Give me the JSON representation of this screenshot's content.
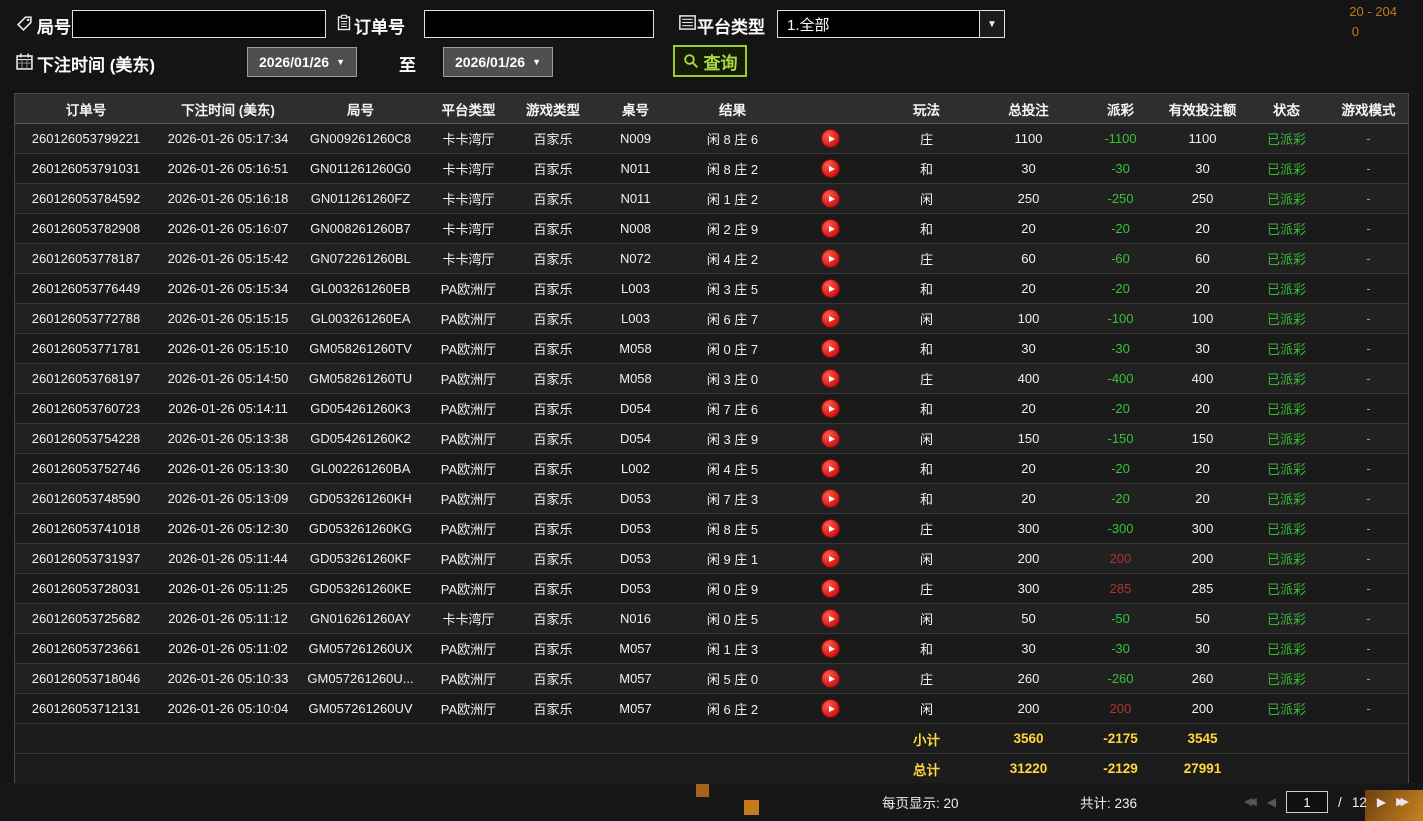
{
  "filters": {
    "round": {
      "label": "局号",
      "value": ""
    },
    "order": {
      "label": "订单号",
      "value": ""
    },
    "platform": {
      "label": "平台类型",
      "value": "1.全部"
    },
    "bet_time_label": "下注时间 (美东)",
    "date_from": "2026/01/26",
    "to_label": "至",
    "date_to": "2026/01/26",
    "query_label": "查询"
  },
  "icons": {
    "round": "tag-icon",
    "order": "clipboard-icon",
    "platform": "list-icon",
    "bet_time": "calendar-icon",
    "query": "search-icon",
    "replay": "play-icon",
    "dropdown": "chevron-down-icon"
  },
  "colors": {
    "query_green": "#99cc33",
    "loss_green": "#35c335",
    "win_red": "#b03434",
    "status_green": "#37b837",
    "summary_yellow": "#ffd83d",
    "replay_red": "#d41414",
    "artifact_orange": "#c2791c"
  },
  "table": {
    "headers": [
      "订单号",
      "下注时间 (美东)",
      "局号",
      "平台类型",
      "游戏类型",
      "桌号",
      "结果",
      "",
      "玩法",
      "总投注",
      "派彩",
      "有效投注额",
      "状态",
      "游戏模式"
    ],
    "rows": [
      [
        "260126053799221",
        "2026-01-26 05:17:34",
        "GN009261260C8",
        "卡卡湾厅",
        "百家乐",
        "N009",
        "闲 8 庄 6",
        "庄",
        "1100",
        "-1100",
        "1100",
        "已派彩",
        "-"
      ],
      [
        "260126053791031",
        "2026-01-26 05:16:51",
        "GN011261260G0",
        "卡卡湾厅",
        "百家乐",
        "N011",
        "闲 8 庄 2",
        "和",
        "30",
        "-30",
        "30",
        "已派彩",
        "-"
      ],
      [
        "260126053784592",
        "2026-01-26 05:16:18",
        "GN011261260FZ",
        "卡卡湾厅",
        "百家乐",
        "N011",
        "闲 1 庄 2",
        "闲",
        "250",
        "-250",
        "250",
        "已派彩",
        "-"
      ],
      [
        "260126053782908",
        "2026-01-26 05:16:07",
        "GN008261260B7",
        "卡卡湾厅",
        "百家乐",
        "N008",
        "闲 2 庄 9",
        "和",
        "20",
        "-20",
        "20",
        "已派彩",
        "-"
      ],
      [
        "260126053778187",
        "2026-01-26 05:15:42",
        "GN072261260BL",
        "卡卡湾厅",
        "百家乐",
        "N072",
        "闲 4 庄 2",
        "庄",
        "60",
        "-60",
        "60",
        "已派彩",
        "-"
      ],
      [
        "260126053776449",
        "2026-01-26 05:15:34",
        "GL003261260EB",
        "PA欧洲厅",
        "百家乐",
        "L003",
        "闲 3 庄 5",
        "和",
        "20",
        "-20",
        "20",
        "已派彩",
        "-"
      ],
      [
        "260126053772788",
        "2026-01-26 05:15:15",
        "GL003261260EA",
        "PA欧洲厅",
        "百家乐",
        "L003",
        "闲 6 庄 7",
        "闲",
        "100",
        "-100",
        "100",
        "已派彩",
        "-"
      ],
      [
        "260126053771781",
        "2026-01-26 05:15:10",
        "GM058261260TV",
        "PA欧洲厅",
        "百家乐",
        "M058",
        "闲 0 庄 7",
        "和",
        "30",
        "-30",
        "30",
        "已派彩",
        "-"
      ],
      [
        "260126053768197",
        "2026-01-26 05:14:50",
        "GM058261260TU",
        "PA欧洲厅",
        "百家乐",
        "M058",
        "闲 3 庄 0",
        "庄",
        "400",
        "-400",
        "400",
        "已派彩",
        "-"
      ],
      [
        "260126053760723",
        "2026-01-26 05:14:11",
        "GD054261260K3",
        "PA欧洲厅",
        "百家乐",
        "D054",
        "闲 7 庄 6",
        "和",
        "20",
        "-20",
        "20",
        "已派彩",
        "-"
      ],
      [
        "260126053754228",
        "2026-01-26 05:13:38",
        "GD054261260K2",
        "PA欧洲厅",
        "百家乐",
        "D054",
        "闲 3 庄 9",
        "闲",
        "150",
        "-150",
        "150",
        "已派彩",
        "-"
      ],
      [
        "260126053752746",
        "2026-01-26 05:13:30",
        "GL002261260BA",
        "PA欧洲厅",
        "百家乐",
        "L002",
        "闲 4 庄 5",
        "和",
        "20",
        "-20",
        "20",
        "已派彩",
        "-"
      ],
      [
        "260126053748590",
        "2026-01-26 05:13:09",
        "GD053261260KH",
        "PA欧洲厅",
        "百家乐",
        "D053",
        "闲 7 庄 3",
        "和",
        "20",
        "-20",
        "20",
        "已派彩",
        "-"
      ],
      [
        "260126053741018",
        "2026-01-26 05:12:30",
        "GD053261260KG",
        "PA欧洲厅",
        "百家乐",
        "D053",
        "闲 8 庄 5",
        "庄",
        "300",
        "-300",
        "300",
        "已派彩",
        "-"
      ],
      [
        "260126053731937",
        "2026-01-26 05:11:44",
        "GD053261260KF",
        "PA欧洲厅",
        "百家乐",
        "D053",
        "闲 9 庄 1",
        "闲",
        "200",
        "200",
        "200",
        "已派彩",
        "-"
      ],
      [
        "260126053728031",
        "2026-01-26 05:11:25",
        "GD053261260KE",
        "PA欧洲厅",
        "百家乐",
        "D053",
        "闲 0 庄 9",
        "庄",
        "300",
        "285",
        "285",
        "已派彩",
        "-"
      ],
      [
        "260126053725682",
        "2026-01-26 05:11:12",
        "GN016261260AY",
        "卡卡湾厅",
        "百家乐",
        "N016",
        "闲 0 庄 5",
        "闲",
        "50",
        "-50",
        "50",
        "已派彩",
        "-"
      ],
      [
        "260126053723661",
        "2026-01-26 05:11:02",
        "GM057261260UX",
        "PA欧洲厅",
        "百家乐",
        "M057",
        "闲 1 庄 3",
        "和",
        "30",
        "-30",
        "30",
        "已派彩",
        "-"
      ],
      [
        "260126053718046",
        "2026-01-26 05:10:33",
        "GM057261260U...",
        "PA欧洲厅",
        "百家乐",
        "M057",
        "闲 5 庄 0",
        "庄",
        "260",
        "-260",
        "260",
        "已派彩",
        "-"
      ],
      [
        "260126053712131",
        "2026-01-26 05:10:04",
        "GM057261260UV",
        "PA欧洲厅",
        "百家乐",
        "M057",
        "闲 6 庄 2",
        "闲",
        "200",
        "200",
        "200",
        "已派彩",
        "-"
      ]
    ],
    "subtotal": {
      "label": "小计",
      "total_bet": "3560",
      "payout": "-2175",
      "valid_bet": "3545"
    },
    "total": {
      "label": "总计",
      "total_bet": "31220",
      "payout": "-2129",
      "valid_bet": "27991"
    }
  },
  "footer": {
    "per_page": "每页显示: 20",
    "total_count": "共计: 236",
    "page": "1",
    "separator": "/",
    "total_pages": "12"
  },
  "artifacts": {
    "top_right_line1": "20  - 204",
    "top_right_line2": "0"
  }
}
